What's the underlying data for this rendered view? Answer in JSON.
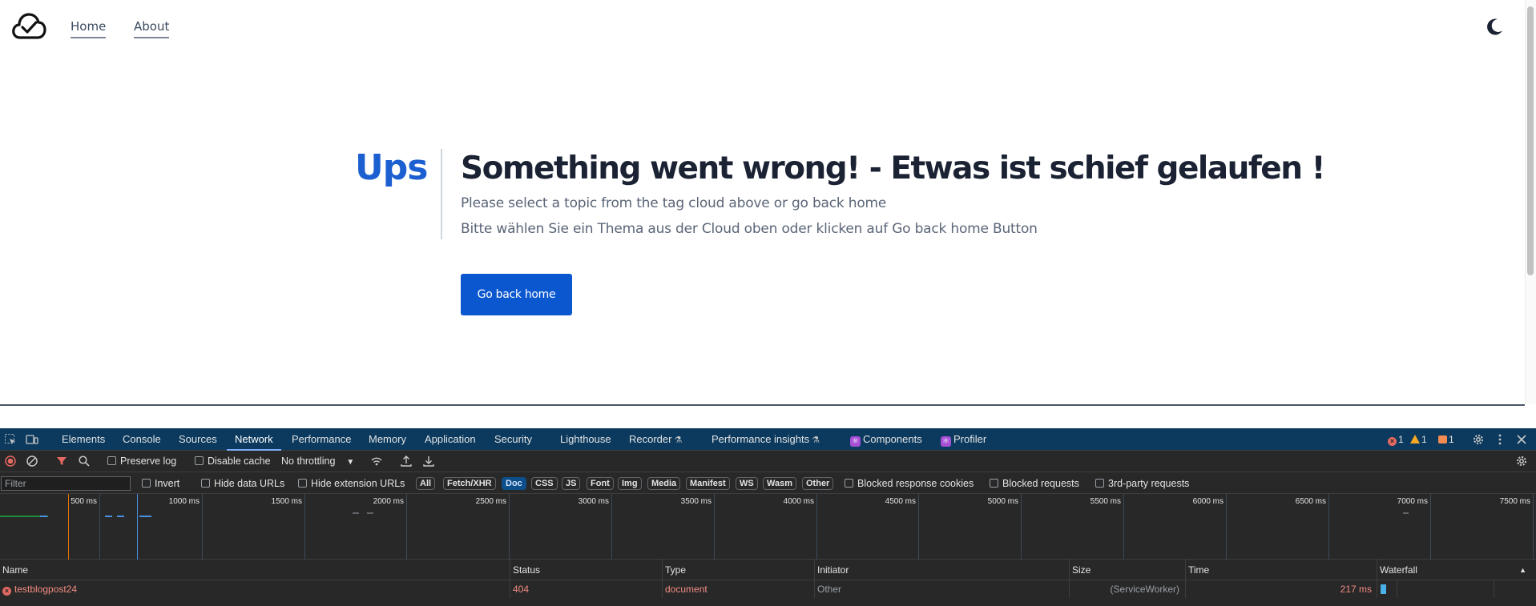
{
  "site": {
    "nav": {
      "home": "Home",
      "about": "About"
    },
    "error": {
      "code": "Ups",
      "title": "Something went wrong! - Etwas ist schief gelaufen !",
      "subtitle_en": "Please select a topic from the tag cloud above or go back home",
      "subtitle_de": "Bitte wählen Sie ein Thema aus der Cloud oben oder klicken auf Go back home Button",
      "button": "Go back home"
    },
    "colors": {
      "accent": "#0b57d0",
      "code": "#1b5fd1",
      "title": "#1a2233"
    }
  },
  "devtools": {
    "tabs": [
      {
        "label": "Elements"
      },
      {
        "label": "Console"
      },
      {
        "label": "Sources"
      },
      {
        "label": "Network"
      },
      {
        "label": "Performance"
      },
      {
        "label": "Memory"
      },
      {
        "label": "Application"
      },
      {
        "label": "Security"
      },
      {
        "label": "Lighthouse"
      },
      {
        "label": "Recorder"
      },
      {
        "label": "Performance insights"
      },
      {
        "label": "Components"
      },
      {
        "label": "Profiler"
      }
    ],
    "active_tab": "Network",
    "counts": {
      "errors": "1",
      "warnings": "1",
      "issues": "1"
    },
    "toolbar": {
      "preserve_log": "Preserve log",
      "disable_cache": "Disable cache",
      "throttling": "No throttling"
    },
    "filter": {
      "placeholder": "Filter",
      "invert": "Invert",
      "hide_data_urls": "Hide data URLs",
      "hide_extension_urls": "Hide extension URLs",
      "types": [
        "All",
        "Fetch/XHR",
        "Doc",
        "CSS",
        "JS",
        "Font",
        "Img",
        "Media",
        "Manifest",
        "WS",
        "Wasm",
        "Other"
      ],
      "active_type": "Doc",
      "blocked_response_cookies": "Blocked response cookies",
      "blocked_requests": "Blocked requests",
      "third_party": "3rd-party requests"
    },
    "overview_ticks": [
      "500 ms",
      "1000 ms",
      "1500 ms",
      "2000 ms",
      "2500 ms",
      "3000 ms",
      "3500 ms",
      "4000 ms",
      "4500 ms",
      "5000 ms",
      "5500 ms",
      "6000 ms",
      "6500 ms",
      "7000 ms",
      "7500 ms"
    ],
    "columns": {
      "name": "Name",
      "status": "Status",
      "type": "Type",
      "initiator": "Initiator",
      "size": "Size",
      "time": "Time",
      "waterfall": "Waterfall"
    },
    "rows": [
      {
        "name": "testblogpost24",
        "status": "404",
        "type": "document",
        "initiator": "Other",
        "size": "(ServiceWorker)",
        "time": "217 ms"
      }
    ],
    "colors": {
      "tabbar": "#0b3a5e",
      "panel": "#282828",
      "error": "#f28b82",
      "active_chip": "#0d4f8b"
    }
  }
}
